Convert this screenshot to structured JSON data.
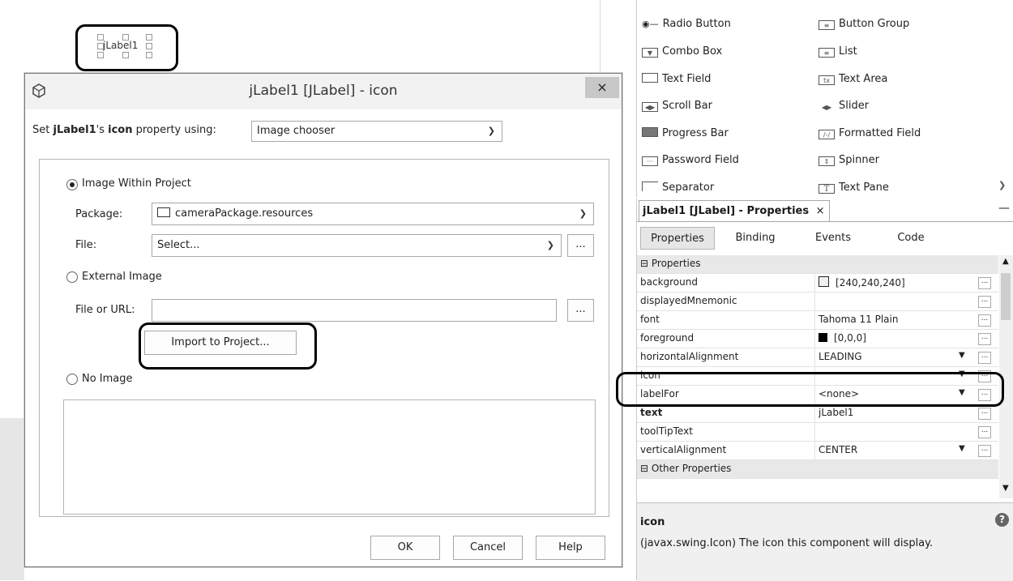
{
  "designer": {
    "component_label": "jLabel1"
  },
  "dialog": {
    "title": "jLabel1 [JLabel] - icon",
    "close_label": "×",
    "intro": {
      "prefix": "Set ",
      "component": "jLabel1",
      "middle": "'s ",
      "property": "icon",
      "suffix": " property using:"
    },
    "chooser_value": "Image chooser",
    "within_project": {
      "label": "Image Within Project",
      "package_label": "Package:",
      "package_value": "cameraPackage.resources",
      "file_label": "File:",
      "file_value": "Select...",
      "browse_label": "..."
    },
    "external": {
      "label": "External Image",
      "url_label": "File or URL:",
      "url_value": "",
      "browse_label": "...",
      "import_label": "Import to Project..."
    },
    "no_image_label": "No Image",
    "buttons": {
      "ok": "OK",
      "cancel": "Cancel",
      "help": "Help"
    }
  },
  "palette": {
    "items": [
      {
        "label": "Radio Button",
        "icon": "radio-button-icon"
      },
      {
        "label": "Button Group",
        "icon": "button-group-icon"
      },
      {
        "label": "Combo Box",
        "icon": "combo-box-icon"
      },
      {
        "label": "List",
        "icon": "list-icon"
      },
      {
        "label": "Text Field",
        "icon": "text-field-icon"
      },
      {
        "label": "Text Area",
        "icon": "text-area-icon"
      },
      {
        "label": "Scroll Bar",
        "icon": "scroll-bar-icon"
      },
      {
        "label": "Slider",
        "icon": "slider-icon"
      },
      {
        "label": "Progress Bar",
        "icon": "progress-bar-icon"
      },
      {
        "label": "Formatted Field",
        "icon": "formatted-field-icon"
      },
      {
        "label": "Password Field",
        "icon": "password-field-icon"
      },
      {
        "label": "Spinner",
        "icon": "spinner-icon"
      },
      {
        "label": "Separator",
        "icon": "separator-icon"
      },
      {
        "label": "Text Pane",
        "icon": "text-pane-icon"
      }
    ]
  },
  "properties": {
    "tab_title": "jLabel1 [JLabel] - Properties",
    "tab_close": "×",
    "minimize": "—",
    "subtabs": [
      "Properties",
      "Binding",
      "Events",
      "Code"
    ],
    "category": "Properties",
    "other_category": "Other Properties",
    "rows": [
      {
        "name": "background",
        "value": "[240,240,240]",
        "swatch": "#f0f0f0"
      },
      {
        "name": "displayedMnemonic",
        "value": ""
      },
      {
        "name": "font",
        "value": "Tahoma 11 Plain"
      },
      {
        "name": "foreground",
        "value": "[0,0,0]",
        "swatch": "#000000"
      },
      {
        "name": "horizontalAlignment",
        "value": "LEADING",
        "dropdown": true
      },
      {
        "name": "icon",
        "value": "",
        "dropdown": true
      },
      {
        "name": "labelFor",
        "value": "<none>",
        "dropdown": true
      },
      {
        "name": "text",
        "value": "jLabel1",
        "bold": true
      },
      {
        "name": "toolTipText",
        "value": ""
      },
      {
        "name": "verticalAlignment",
        "value": "CENTER",
        "dropdown": true
      }
    ],
    "dots_label": "...",
    "help_title": "icon",
    "help_text": "(javax.swing.Icon) The icon this component will display."
  }
}
